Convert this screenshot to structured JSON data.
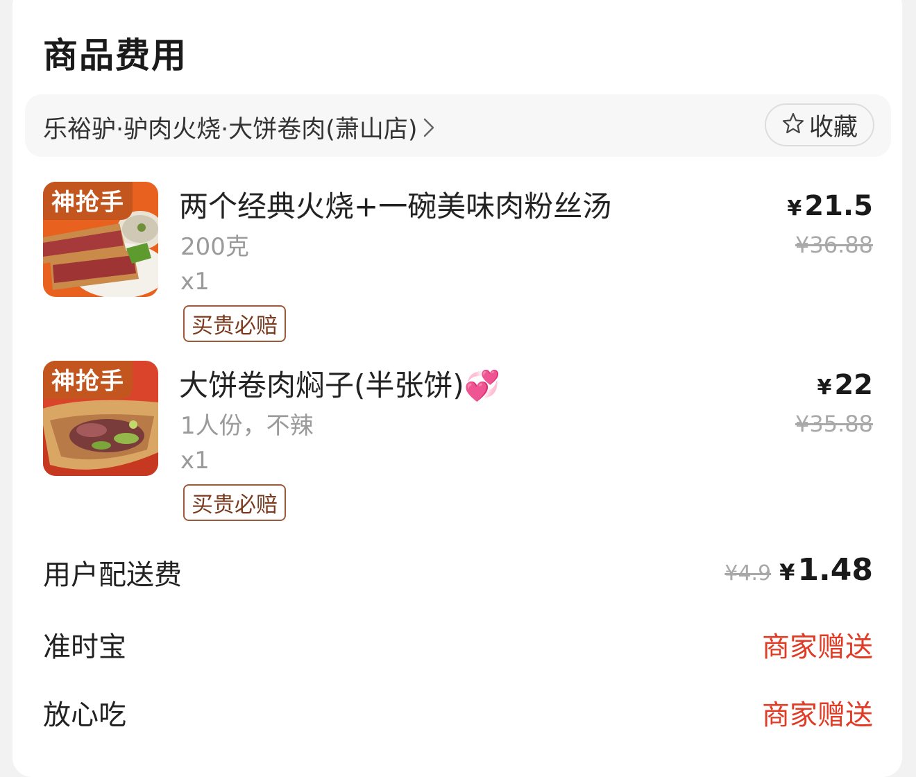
{
  "section": {
    "title": "商品费用"
  },
  "store": {
    "name": "乐裕驴·驴肉火烧·大饼卷肉(萧山店)",
    "favorite_label": "收藏"
  },
  "items": [
    {
      "tag": "神抢手",
      "name": "两个经典火烧+一碗美味肉粉丝汤",
      "spec": "200克",
      "qty": "x1",
      "badge": "买贵必赔",
      "currency": "¥",
      "price": "21.5",
      "original_price": "¥36.88",
      "image": "donkey-meat-flatbread-photo"
    },
    {
      "tag": "神抢手",
      "name": "大饼卷肉焖子(半张饼)💞",
      "spec": "1人份，不辣",
      "qty": "x1",
      "badge": "买贵必赔",
      "currency": "¥",
      "price": "22",
      "original_price": "¥35.88",
      "image": "rolled-pancake-meat-photo"
    }
  ],
  "fees": {
    "delivery": {
      "label": "用户配送费",
      "original": "¥4.9",
      "currency": "¥",
      "amount": "1.48"
    },
    "on_time": {
      "label": "准时宝",
      "value": "商家赠送"
    },
    "assured": {
      "label": "放心吃",
      "value": "商家赠送"
    }
  },
  "colors": {
    "promo_red": "#e23b25",
    "badge_brown": "#7a3a1e",
    "tag_orange": "#c2561e"
  }
}
